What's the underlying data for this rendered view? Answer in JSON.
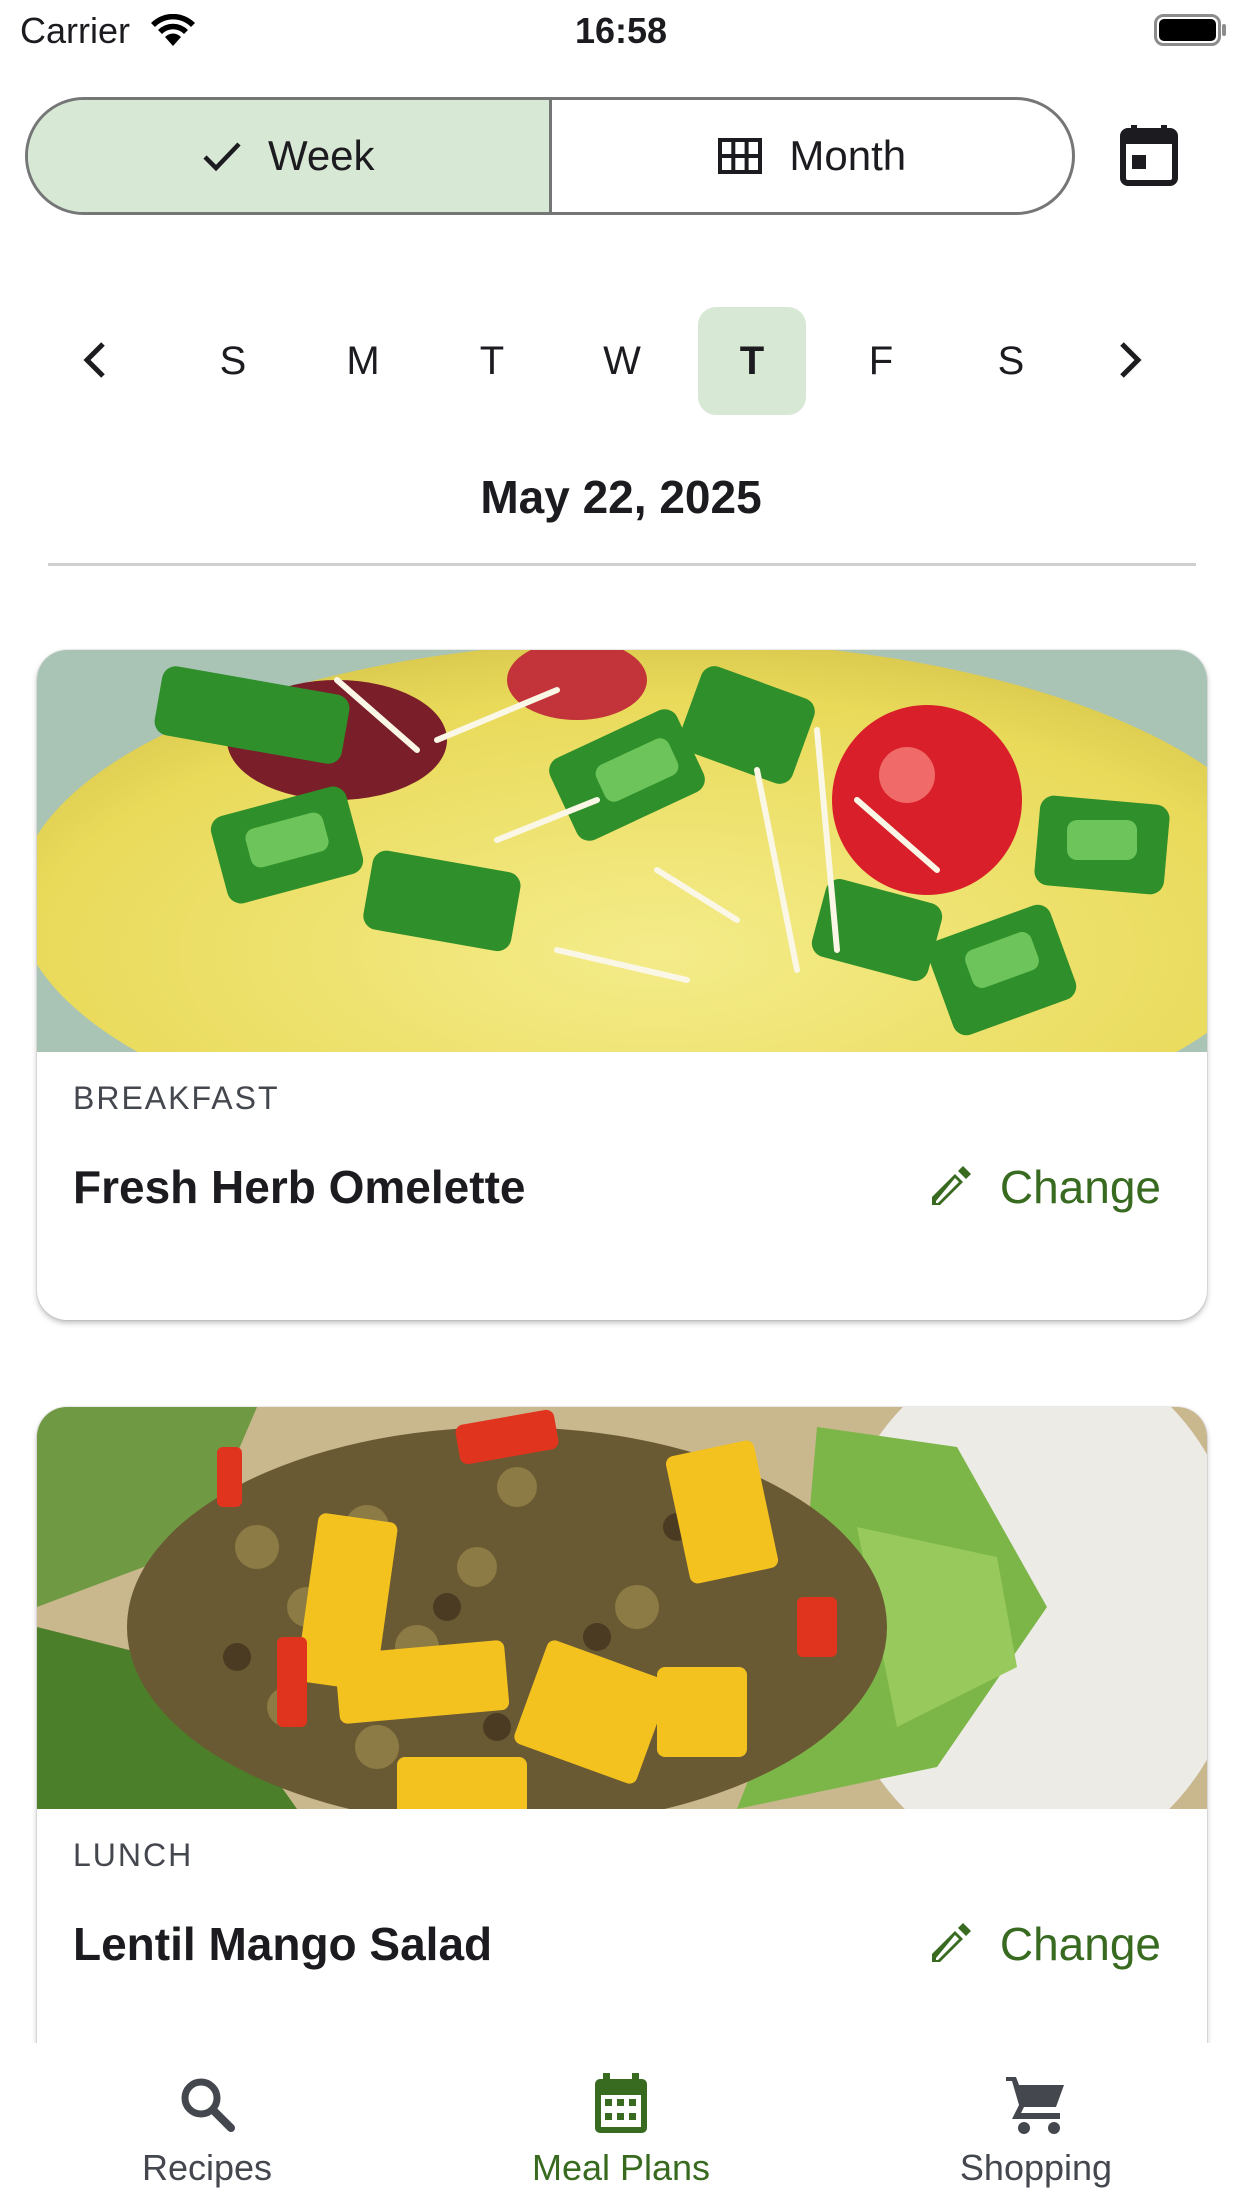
{
  "status_bar": {
    "carrier": "Carrier",
    "time": "16:58"
  },
  "view_toggle": {
    "week_label": "Week",
    "month_label": "Month",
    "selected": "Week"
  },
  "week_strip": {
    "days": [
      "S",
      "M",
      "T",
      "W",
      "T",
      "F",
      "S"
    ],
    "selected_index": 4
  },
  "selected_date": "May 22, 2025",
  "meals": [
    {
      "type": "BREAKFAST",
      "name": "Fresh Herb Omelette",
      "action": "Change"
    },
    {
      "type": "LUNCH",
      "name": "Lentil Mango Salad",
      "action": "Change"
    }
  ],
  "bottom_nav": {
    "items": [
      {
        "label": "Recipes",
        "icon": "search-icon"
      },
      {
        "label": "Meal Plans",
        "icon": "calendar-icon"
      },
      {
        "label": "Shopping",
        "icon": "cart-icon"
      }
    ],
    "active": "Meal Plans"
  },
  "colors": {
    "accent": "#386a20",
    "selected_bg": "#d7e8d4",
    "outline": "#747775"
  }
}
